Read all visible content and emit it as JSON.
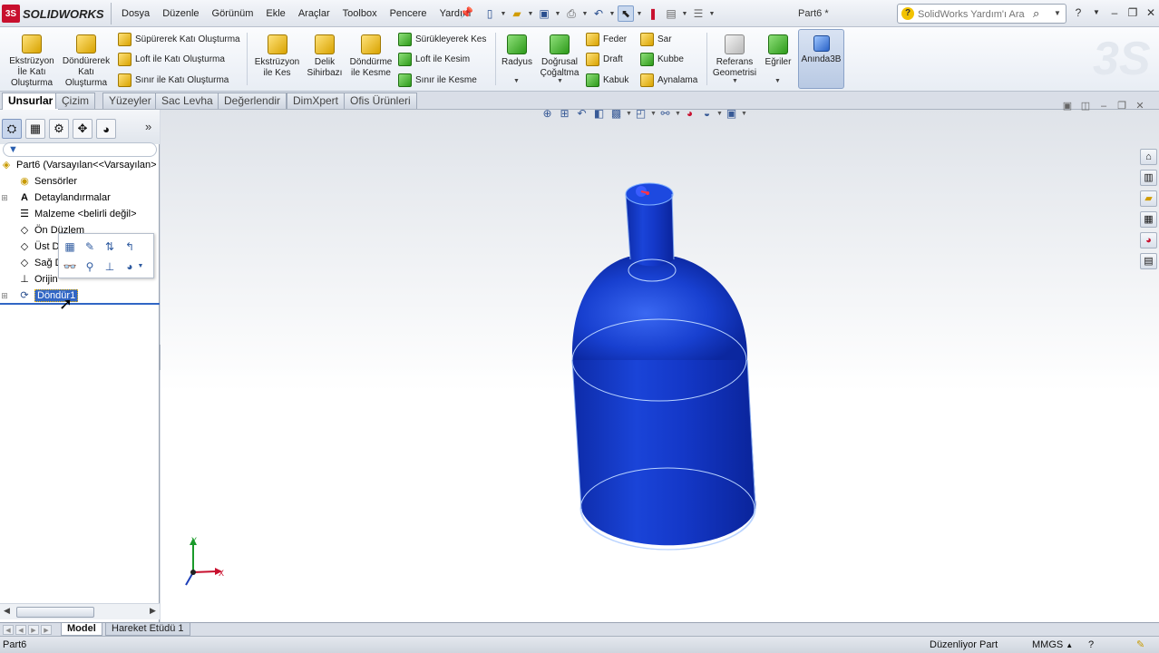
{
  "app": {
    "brand": "SOLIDWORKS",
    "document_title": "Part6 *"
  },
  "menu": [
    "Dosya",
    "Düzenle",
    "Görünüm",
    "Ekle",
    "Araçlar",
    "Toolbox",
    "Pencere",
    "Yardım"
  ],
  "search": {
    "placeholder": "SolidWorks Yardım'ı Ara"
  },
  "ribbon": {
    "extrude_boss": "Ekstrüzyon\nİle Katı\nOluşturma",
    "revolve_boss": "Döndürerek\nKatı\nOluşturma",
    "sweep_boss": "Süpürerek Katı Oluşturma",
    "loft_boss": "Loft ile Katı Oluşturma",
    "boundary_boss": "Sınır ile Katı Oluşturma",
    "extrude_cut": "Ekstrüzyon\nile Kes",
    "hole_wizard": "Delik\nSihirbazı",
    "revolve_cut": "Döndürme\nile Kesme",
    "swept_cut": "Sürükleyerek Kes",
    "lofted_cut": "Loft ile Kesim",
    "boundary_cut": "Sınır ile Kesme",
    "fillet": "Radyus",
    "linear_pattern": "Doğrusal\nÇoğaltma",
    "rib": "Feder",
    "draft": "Draft",
    "shell": "Kabuk",
    "wrap": "Sar",
    "dome": "Kubbe",
    "mirror": "Aynalama",
    "reference_geometry": "Referans\nGeometrisi",
    "curves": "Eğriler",
    "instant3d": "Anında3B"
  },
  "tabs": [
    "Unsurlar",
    "Çizim",
    "Yüzeyler",
    "Sac Levha",
    "Değerlendir",
    "DimXpert",
    "Ofis Ürünleri"
  ],
  "feature_tree": {
    "root": "Part6  (Varsayılan<<Varsayılan>",
    "sensors": "Sensörler",
    "annotations": "Detaylandırmalar",
    "material": "Malzeme <belirli değil>",
    "front_plane": "Ön Düzlem",
    "top_plane": "Üst D",
    "right_plane": "Sağ D",
    "origin": "Orijin",
    "revolve_feature": "Döndür1"
  },
  "bottom_tabs": [
    "Model",
    "Hareket Etüdü 1"
  ],
  "status": {
    "left": "Part6",
    "mode": "Düzenliyor Part",
    "units": "MMGS",
    "units_arrow": "▲",
    "help": "?"
  },
  "colors": {
    "part_blue": "#1438c8",
    "selection_blue": "#3166c5"
  }
}
